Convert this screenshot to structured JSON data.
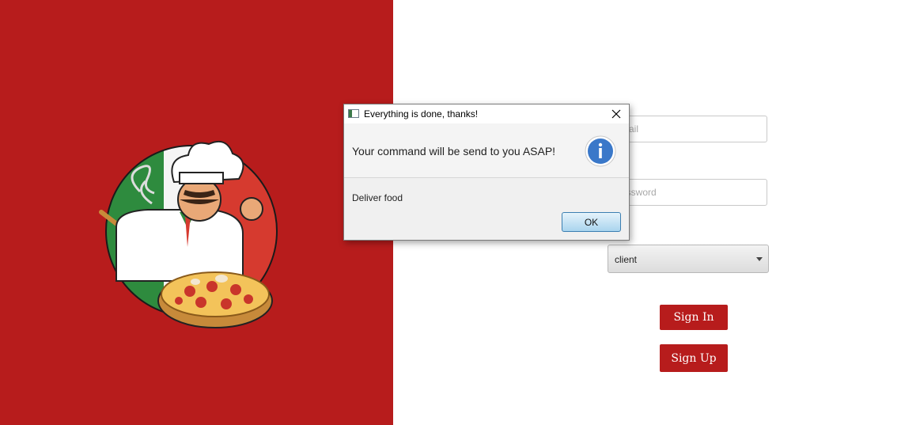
{
  "login": {
    "email_placeholder": "Email",
    "password_placeholder": "Password",
    "role_selected": "client",
    "sign_in_label": "Sign In",
    "sign_up_label": "Sign Up"
  },
  "dialog": {
    "title": "Everything is done, thanks!",
    "header": "Your command will be send to you ASAP!",
    "content": "Deliver food",
    "ok_label": "OK",
    "icon": "info-icon"
  },
  "colors": {
    "brand_red": "#b71c1c",
    "info_blue": "#3a78c9",
    "ok_border": "#3c7fb1"
  },
  "icons": {
    "logo": "chef-pizza-logo",
    "dropdown": "chevron-down-icon",
    "close": "close-icon"
  }
}
